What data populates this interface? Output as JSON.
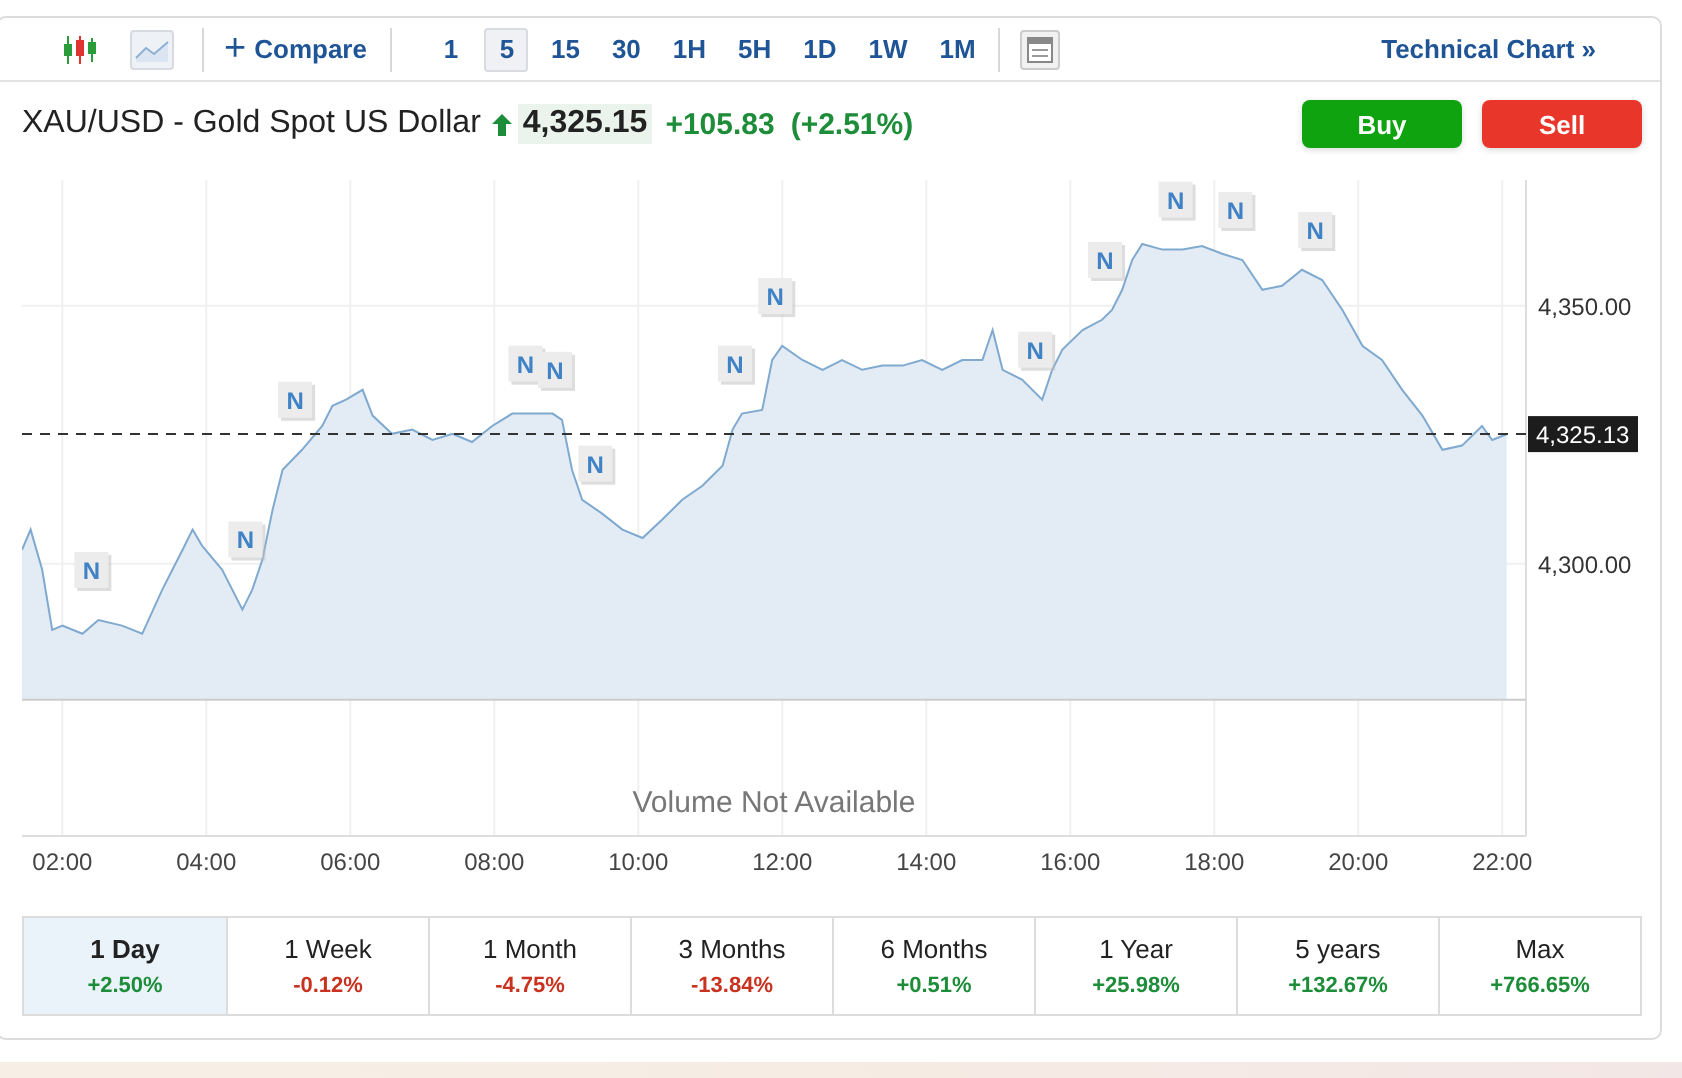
{
  "toolbar": {
    "chart_types": [
      {
        "kind": "candles",
        "selected": false
      },
      {
        "kind": "area",
        "selected": true
      }
    ],
    "compare": {
      "icon": "+",
      "label": "Compare"
    },
    "intervals": [
      {
        "label": "1",
        "selected": false
      },
      {
        "label": "5",
        "selected": true
      },
      {
        "label": "15",
        "selected": false
      },
      {
        "label": "30",
        "selected": false
      },
      {
        "label": "1H",
        "selected": false
      },
      {
        "label": "5H",
        "selected": false
      },
      {
        "label": "1D",
        "selected": false
      },
      {
        "label": "1W",
        "selected": false
      },
      {
        "label": "1M",
        "selected": false
      }
    ],
    "technical_link": "Technical Chart »"
  },
  "header": {
    "title": "XAU/USD - Gold Spot US Dollar",
    "rising": true,
    "price": "4,325.15",
    "change": "+105.83",
    "change_percent": "(+2.51%)",
    "buttons": [
      {
        "label": "Buy",
        "kind": "buy"
      },
      {
        "label": "Sell",
        "kind": "sell"
      }
    ]
  },
  "chart": {
    "volume_note": "Volume Not Available",
    "chart_data": {
      "type": "area",
      "xlim": [
        1.44,
        22.33
      ],
      "ylim": [
        4247.2,
        4374.4
      ],
      "grid": true,
      "xticks": [
        {
          "value": 2,
          "label": "02:00"
        },
        {
          "value": 4,
          "label": "04:00"
        },
        {
          "value": 6,
          "label": "06:00"
        },
        {
          "value": 8,
          "label": "08:00"
        },
        {
          "value": 10,
          "label": "10:00"
        },
        {
          "value": 12,
          "label": "12:00"
        },
        {
          "value": 14,
          "label": "14:00"
        },
        {
          "value": 16,
          "label": "16:00"
        },
        {
          "value": 18,
          "label": "18:00"
        },
        {
          "value": 20,
          "label": "20:00"
        },
        {
          "value": 22,
          "label": "22:00"
        }
      ],
      "yticks": [
        {
          "value": 4300,
          "label": "4,300.00"
        },
        {
          "value": 4350,
          "label": "4,350.00"
        }
      ],
      "x": [
        1.44,
        1.56,
        1.72,
        1.86,
        2.0,
        2.28,
        2.5,
        2.83,
        3.11,
        3.39,
        3.67,
        3.81,
        3.94,
        4.22,
        4.5,
        4.64,
        4.78,
        4.92,
        5.06,
        5.33,
        5.61,
        5.75,
        5.94,
        6.17,
        6.31,
        6.58,
        6.86,
        7.14,
        7.42,
        7.69,
        7.97,
        8.25,
        8.53,
        8.81,
        8.94,
        9.08,
        9.22,
        9.5,
        9.78,
        10.06,
        10.33,
        10.61,
        10.89,
        11.17,
        11.31,
        11.44,
        11.72,
        11.86,
        12.0,
        12.28,
        12.56,
        12.83,
        13.11,
        13.39,
        13.67,
        13.94,
        14.22,
        14.5,
        14.78,
        14.92,
        15.06,
        15.33,
        15.61,
        15.75,
        15.89,
        16.17,
        16.44,
        16.58,
        16.72,
        16.86,
        17.0,
        17.28,
        17.56,
        17.83,
        18.11,
        18.39,
        18.67,
        18.94,
        19.22,
        19.5,
        19.78,
        20.06,
        20.33,
        20.61,
        20.89,
        21.17,
        21.44,
        21.72,
        21.86,
        22.06
      ],
      "series": [
        {
          "color": "#7fa9cf",
          "values": [
            4302.7,
            4306.6,
            4298.8,
            4287.2,
            4288.0,
            4286.4,
            4289.1,
            4288.0,
            4286.4,
            4295.0,
            4302.7,
            4306.6,
            4303.5,
            4298.8,
            4291.1,
            4295.0,
            4300.8,
            4310.5,
            4318.2,
            4322.1,
            4326.7,
            4330.6,
            4331.8,
            4333.7,
            4328.7,
            4325.2,
            4326.0,
            4324.0,
            4325.2,
            4323.6,
            4326.7,
            4329.1,
            4329.1,
            4329.1,
            4327.9,
            4318.2,
            4312.4,
            4309.7,
            4306.6,
            4305.0,
            4308.5,
            4312.4,
            4315.1,
            4319.0,
            4326.0,
            4329.1,
            4329.8,
            4339.5,
            4342.2,
            4339.5,
            4337.6,
            4339.5,
            4337.6,
            4338.4,
            4338.4,
            4339.5,
            4337.6,
            4339.5,
            4339.5,
            4345.3,
            4337.6,
            4335.7,
            4331.8,
            4337.6,
            4341.5,
            4345.3,
            4347.3,
            4349.2,
            4353.1,
            4358.9,
            4362.0,
            4360.9,
            4360.9,
            4361.6,
            4360.1,
            4358.9,
            4353.1,
            4353.9,
            4357.0,
            4355.0,
            4349.2,
            4342.2,
            4339.5,
            4333.7,
            4328.7,
            4322.1,
            4322.9,
            4326.7,
            4324.0,
            4325.1
          ]
        }
      ],
      "annotations": [
        {
          "x": 2.5,
          "y": 4289.1,
          "text": "N"
        },
        {
          "x": 4.64,
          "y": 4295.0,
          "text": "N"
        },
        {
          "x": 5.33,
          "y": 4322.1,
          "text": "N"
        },
        {
          "x": 8.53,
          "y": 4329.1,
          "text": "N"
        },
        {
          "x": 8.94,
          "y": 4327.9,
          "text": "N"
        },
        {
          "x": 9.5,
          "y": 4309.7,
          "text": "N"
        },
        {
          "x": 11.44,
          "y": 4329.1,
          "text": "N"
        },
        {
          "x": 12.0,
          "y": 4342.2,
          "text": "N"
        },
        {
          "x": 15.61,
          "y": 4331.8,
          "text": "N"
        },
        {
          "x": 16.58,
          "y": 4349.2,
          "text": "N"
        },
        {
          "x": 17.56,
          "y": 4360.9,
          "text": "N"
        },
        {
          "x": 18.39,
          "y": 4358.9,
          "text": "N"
        },
        {
          "x": 19.5,
          "y": 4355.0,
          "text": "N"
        }
      ],
      "ref_lines": [
        {
          "axis": "y",
          "value": 4325.13,
          "label": "4,325.13"
        },
        {
          "axis": "y",
          "value": 4273.6
        }
      ]
    }
  },
  "periods": [
    {
      "label": "1 Day",
      "change": "+2.50%",
      "rising": true,
      "selected": true
    },
    {
      "label": "1 Week",
      "change": "-0.12%",
      "rising": false,
      "selected": false
    },
    {
      "label": "1 Month",
      "change": "-4.75%",
      "rising": false,
      "selected": false
    },
    {
      "label": "3 Months",
      "change": "-13.84%",
      "rising": false,
      "selected": false
    },
    {
      "label": "6 Months",
      "change": "+0.51%",
      "rising": true,
      "selected": false
    },
    {
      "label": "1 Year",
      "change": "+25.98%",
      "rising": true,
      "selected": false
    },
    {
      "label": "5 years",
      "change": "+132.67%",
      "rising": true,
      "selected": false
    },
    {
      "label": "Max",
      "change": "+766.65%",
      "rising": true,
      "selected": false
    }
  ]
}
